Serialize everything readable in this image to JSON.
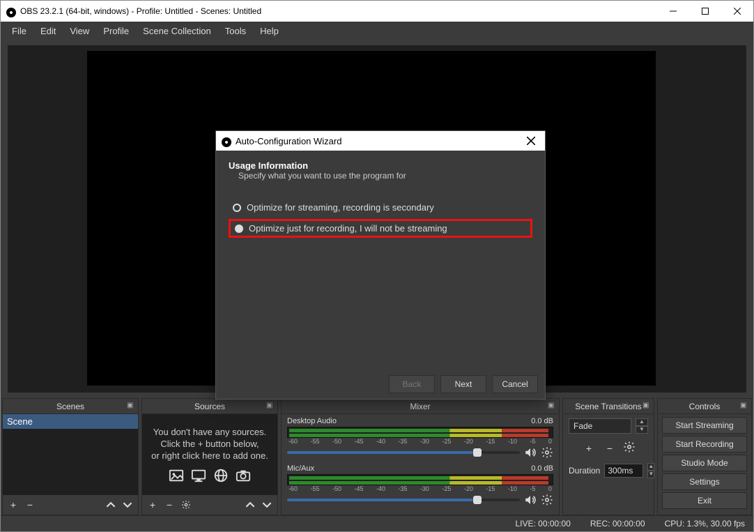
{
  "titlebar": {
    "text": "OBS 23.2.1 (64-bit, windows) - Profile: Untitled - Scenes: Untitled"
  },
  "menu": {
    "file": "File",
    "edit": "Edit",
    "view": "View",
    "profile": "Profile",
    "scene_collection": "Scene Collection",
    "tools": "Tools",
    "help": "Help"
  },
  "panels": {
    "scenes": {
      "title": "Scenes",
      "items": [
        "Scene"
      ]
    },
    "sources": {
      "title": "Sources",
      "empty1": "You don't have any sources.",
      "empty2": "Click the + button below,",
      "empty3": "or right click here to add one."
    },
    "mixer": {
      "title": "Mixer",
      "channels": [
        {
          "name": "Desktop Audio",
          "db": "0.0 dB",
          "ticks": [
            "-60",
            "-55",
            "-50",
            "-45",
            "-40",
            "-35",
            "-30",
            "-25",
            "-20",
            "-15",
            "-10",
            "-5",
            "0"
          ]
        },
        {
          "name": "Mic/Aux",
          "db": "0.0 dB",
          "ticks": [
            "-60",
            "-55",
            "-50",
            "-45",
            "-40",
            "-35",
            "-30",
            "-25",
            "-20",
            "-15",
            "-10",
            "-5",
            "0"
          ]
        }
      ]
    },
    "transitions": {
      "title": "Scene Transitions",
      "fade": "Fade",
      "duration_label": "Duration",
      "duration_value": "300ms"
    },
    "controls": {
      "title": "Controls",
      "start_streaming": "Start Streaming",
      "start_recording": "Start Recording",
      "studio_mode": "Studio Mode",
      "settings": "Settings",
      "exit": "Exit"
    }
  },
  "statusbar": {
    "live": "LIVE: 00:00:00",
    "rec": "REC: 00:00:00",
    "cpu": "CPU: 1.3%, 30.00 fps"
  },
  "dialog": {
    "title": "Auto-Configuration Wizard",
    "heading": "Usage Information",
    "sub": "Specify what you want to use the program for",
    "opt1": "Optimize for streaming, recording is secondary",
    "opt2": "Optimize just for recording, I will not be streaming",
    "back": "Back",
    "next": "Next",
    "cancel": "Cancel"
  }
}
